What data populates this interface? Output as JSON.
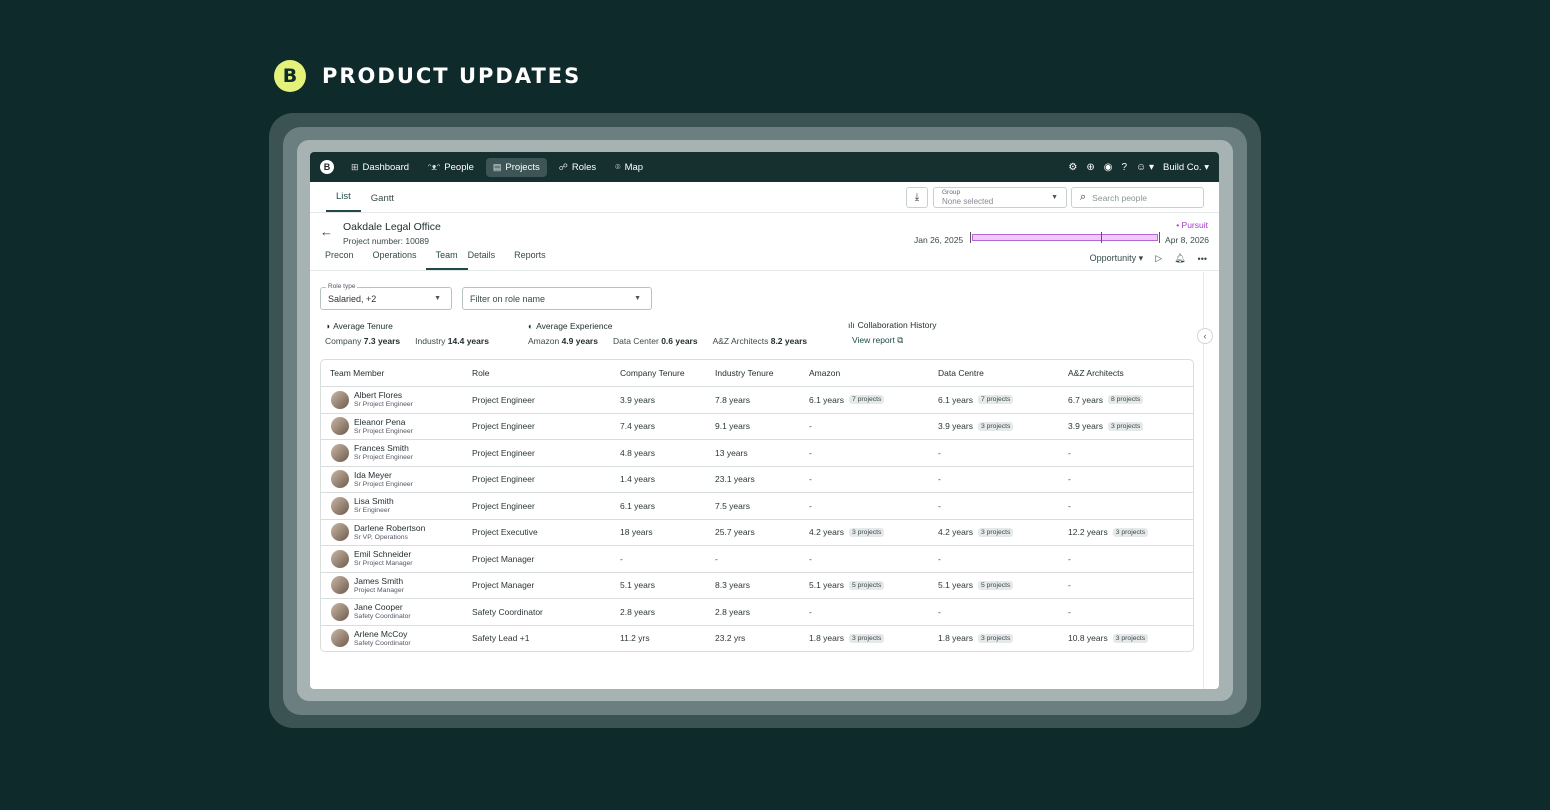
{
  "banner": {
    "logo_letter": "B",
    "title": "PRODUCT UPDATES"
  },
  "nav": {
    "logo_letter": "B",
    "items": [
      {
        "label": "Dashboard",
        "icon": "grid-icon"
      },
      {
        "label": "People",
        "icon": "people-icon"
      },
      {
        "label": "Projects",
        "icon": "building-icon"
      },
      {
        "label": "Roles",
        "icon": "roles-icon"
      },
      {
        "label": "Map",
        "icon": "pin-icon"
      }
    ],
    "company": "Build Co."
  },
  "view_tabs": [
    "List",
    "Gantt"
  ],
  "group": {
    "label": "Group",
    "value": "None selected"
  },
  "search": {
    "placeholder": "Search people"
  },
  "project": {
    "name": "Oakdale Legal Office",
    "number": "Project number: 10089",
    "status": "• Pursuit",
    "start": "Jan 26, 2025",
    "end": "Apr 8, 2026",
    "tabs": [
      "Precon",
      "Operations",
      "Team",
      "Details",
      "Reports"
    ],
    "stage": "Opportunity"
  },
  "filters": {
    "role_type_label": "Role type",
    "role_type_value": "Salaried, +2",
    "role_name_placeholder": "Filter on role name"
  },
  "stats": {
    "tenure": {
      "title": "Average Tenure",
      "items": [
        {
          "label": "Company",
          "value": "7.3 years"
        },
        {
          "label": "Industry",
          "value": "14.4 years"
        }
      ]
    },
    "experience": {
      "title": "Average Experience",
      "items": [
        {
          "label": "Amazon",
          "value": "4.9 years"
        },
        {
          "label": "Data Center",
          "value": "0.6 years"
        },
        {
          "label": "A&Z Architects",
          "value": "8.2 years"
        }
      ]
    },
    "collab": {
      "title": "Collaboration History",
      "link": "View report"
    }
  },
  "table": {
    "headers": [
      "Team Member",
      "Role",
      "Company Tenure",
      "Industry Tenure",
      "Amazon",
      "Data Centre",
      "A&Z Architects"
    ],
    "rows": [
      {
        "name": "Albert Flores",
        "title": "Sr Project Engineer",
        "role": "Project Engineer",
        "company": "3.9 years",
        "industry": "7.8 years",
        "amazon": "6.1 years",
        "amazon_p": "7 projects",
        "dc": "6.1 years",
        "dc_p": "7 projects",
        "az": "6.7 years",
        "az_p": "8 projects"
      },
      {
        "name": "Eleanor Pena",
        "title": "Sr Project Engineer",
        "role": "Project Engineer",
        "company": "7.4 years",
        "industry": "9.1 years",
        "amazon": "-",
        "amazon_p": "",
        "dc": "3.9 years",
        "dc_p": "3 projects",
        "az": "3.9 years",
        "az_p": "3 projects"
      },
      {
        "name": "Frances Smith",
        "title": "Sr Project Engineer",
        "role": "Project Engineer",
        "company": "4.8 years",
        "industry": "13 years",
        "amazon": "-",
        "amazon_p": "",
        "dc": "-",
        "dc_p": "",
        "az": "-",
        "az_p": ""
      },
      {
        "name": "Ida Meyer",
        "title": "Sr Project Engineer",
        "role": "Project Engineer",
        "company": "1.4 years",
        "industry": "23.1 years",
        "amazon": "-",
        "amazon_p": "",
        "dc": "-",
        "dc_p": "",
        "az": "-",
        "az_p": ""
      },
      {
        "name": "Lisa Smith",
        "title": "Sr Engineer",
        "role": "Project Engineer",
        "company": "6.1 years",
        "industry": "7.5 years",
        "amazon": "-",
        "amazon_p": "",
        "dc": "-",
        "dc_p": "",
        "az": "-",
        "az_p": ""
      },
      {
        "name": "Darlene Robertson",
        "title": "Sr VP, Operations",
        "role": "Project Executive",
        "company": "18 years",
        "industry": "25.7 years",
        "amazon": "4.2 years",
        "amazon_p": "3 projects",
        "dc": "4.2 years",
        "dc_p": "3 projects",
        "az": "12.2 years",
        "az_p": "3 projects"
      },
      {
        "name": "Emil Schneider",
        "title": "Sr Project Manager",
        "role": "Project Manager",
        "company": "-",
        "industry": "-",
        "amazon": "-",
        "amazon_p": "",
        "dc": "-",
        "dc_p": "",
        "az": "-",
        "az_p": ""
      },
      {
        "name": "James Smith",
        "title": "Project Manager",
        "role": "Project Manager",
        "company": "5.1 years",
        "industry": "8.3 years",
        "amazon": "5.1 years",
        "amazon_p": "5 projects",
        "dc": "5.1 years",
        "dc_p": "5 projects",
        "az": "-",
        "az_p": ""
      },
      {
        "name": "Jane Cooper",
        "title": "Safety Coordinator",
        "role": "Safety Coordinator",
        "company": "2.8 years",
        "industry": "2.8 years",
        "amazon": "-",
        "amazon_p": "",
        "dc": "-",
        "dc_p": "",
        "az": "-",
        "az_p": ""
      },
      {
        "name": "Arlene McCoy",
        "title": "Safety Coordinator",
        "role": "Safety Lead +1",
        "company": "11.2 yrs",
        "industry": "23.2 yrs",
        "amazon": "1.8 years",
        "amazon_p": "3 projects",
        "dc": "1.8 years",
        "dc_p": "3 projects",
        "az": "10.8 years",
        "az_p": "3 projects"
      }
    ]
  },
  "colors": {
    "bg": "#0f2a2b",
    "nav": "#15302f",
    "accent": "#e4f27a",
    "status": "#a43bd0"
  }
}
